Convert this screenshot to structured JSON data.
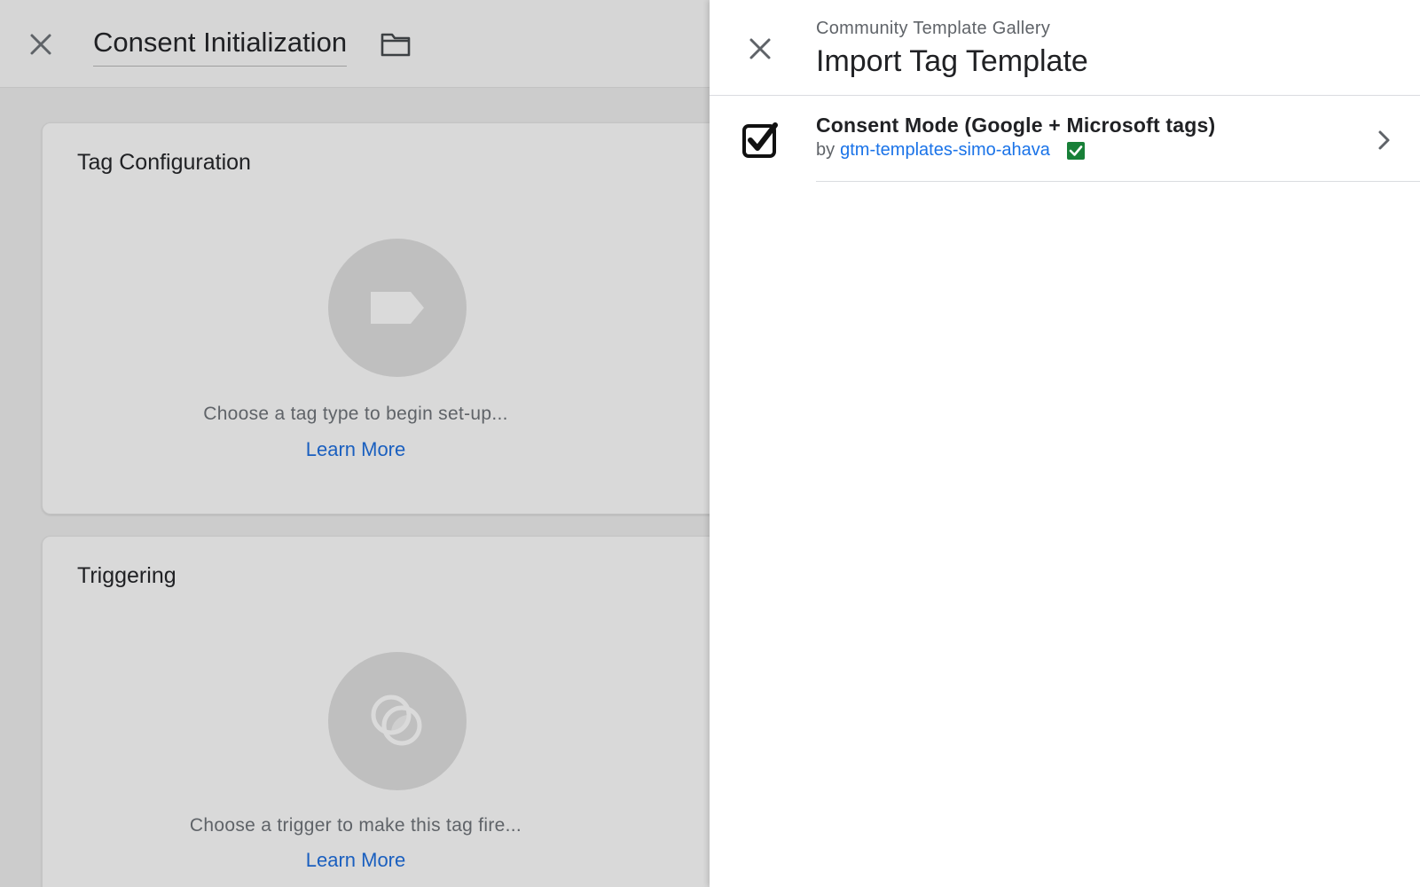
{
  "editor": {
    "title": "Consent Initialization",
    "tag_configuration": {
      "title": "Tag Configuration",
      "hint": "Choose a tag type to begin set-up...",
      "learn_more": "Learn More"
    },
    "triggering": {
      "title": "Triggering",
      "hint": "Choose a trigger to make this tag fire...",
      "learn_more": "Learn More"
    }
  },
  "panel": {
    "subtitle": "Community Template Gallery",
    "title": "Import Tag Template",
    "templates": [
      {
        "name": "Consent Mode (Google + Microsoft tags)",
        "by_label": "by",
        "author": "gtm-templates-simo-ahava",
        "checked": true,
        "verified": true
      }
    ]
  },
  "colors": {
    "link": "#1a73e8",
    "verified": "#188038",
    "dim_background": "#d9d9d9"
  },
  "icons": [
    "close-icon",
    "folder-icon",
    "tag-icon",
    "trigger-icon",
    "checkbox-checked-icon",
    "verified-check-icon",
    "chevron-right-icon"
  ]
}
